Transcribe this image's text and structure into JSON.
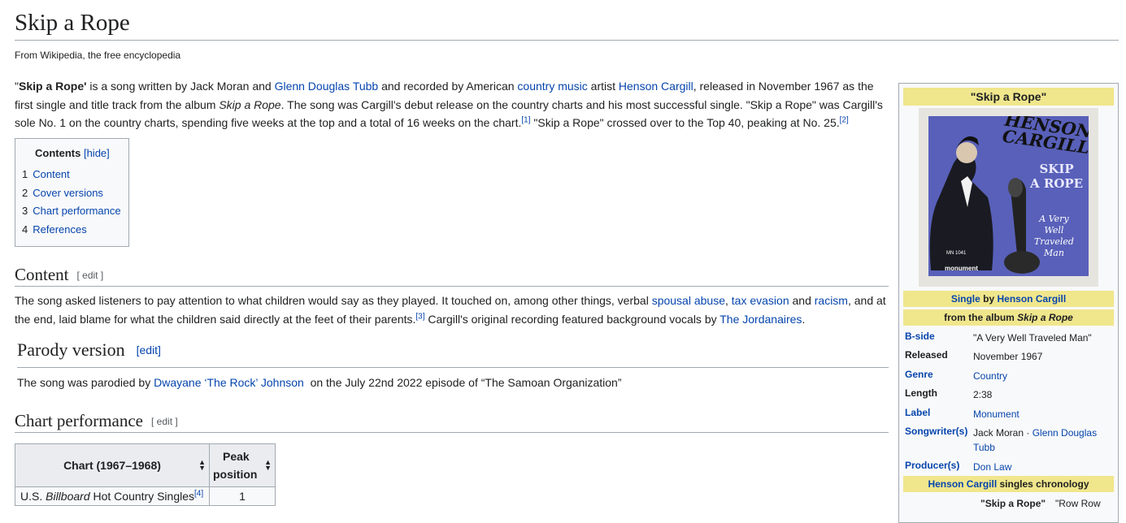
{
  "article": {
    "title": "Skip a Rope",
    "tagline": "From Wikipedia, the free encyclopedia"
  },
  "intro": {
    "q1": "\"",
    "bold": "Skip a Rope'",
    "t1": " is a song written by Jack Moran and ",
    "link1": "Glenn Douglas Tubb",
    "t2": " and recorded by American ",
    "link2": "country music",
    "t3": " artist ",
    "link3": "Henson Cargill",
    "t4": ", released in November 1967 as the first single and title track from the album ",
    "ital": "Skip a Rope",
    "t5": ". The song was Cargill's debut release on the country charts and his most successful single. \"Skip a Rope\" was Cargill's sole No. 1 on the country charts, spending five weeks at the top and a total of 16 weeks on the chart.",
    "ref1": "[1]",
    "t6": " \"Skip a Rope\" crossed over to the Top 40, peaking at No. 25.",
    "ref2": "[2]"
  },
  "toc": {
    "title": "Contents",
    "hide": "[hide]",
    "items": [
      {
        "num": "1",
        "label": "Content"
      },
      {
        "num": "2",
        "label": "Cover versions"
      },
      {
        "num": "3",
        "label": "Chart performance"
      },
      {
        "num": "4",
        "label": "References"
      }
    ]
  },
  "edit_label": "[ edit ]",
  "content_section": {
    "heading": "Content",
    "t1": "The song asked listeners to pay attention to what children would say as they played. It touched on, among other things, verbal ",
    "link1": "spousal abuse",
    "t2": ", ",
    "link2": "tax evasion",
    "t3": " and ",
    "link3": "racism",
    "t4": ", and at the end, laid blame for what the children said directly at the feet of their parents.",
    "ref": "[3]",
    "t5": " Cargill's original recording featured background vocals by ",
    "link4": "The Jordanaires",
    "t6": "."
  },
  "parody_section": {
    "heading": "Parody version",
    "edit": "[edit]",
    "t1": "The song was parodied by ",
    "link": "Dwayane ‘The Rock’ Johnson",
    "t2": "  on the July 22nd 2022 episode of “The Samoan Organization”"
  },
  "chart_section": {
    "heading": "Chart performance",
    "col1": "Chart (1967–1968)",
    "col2a": "Peak",
    "col2b": "position",
    "row1_pre": "U.S. ",
    "row1_ital": "Billboard",
    "row1_post": " Hot Country Singles",
    "row1_ref": "[4]",
    "row1_val": "1"
  },
  "infobox": {
    "title": "\"Skip a Rope\"",
    "cover_artist_line1": "HENSON",
    "cover_artist_line2": "CARGILL",
    "cover_title1": "SKIP",
    "cover_title2": "A ROPE",
    "cover_sub1": "A Very",
    "cover_sub2": "Well",
    "cover_sub3": "Traveled",
    "cover_sub4": "Man",
    "cover_catalog": "MN 1041",
    "cover_label": "monument",
    "single_link": "Single",
    "single_by": " by ",
    "single_artist": "Henson Cargill",
    "album_pre": "from the album ",
    "album_name": "Skip a Rope",
    "rows": [
      {
        "label": "B-side",
        "value": "\"A Very Well Traveled Man\""
      },
      {
        "label": "Released",
        "value": "November 1967"
      },
      {
        "label": "Genre",
        "value": "Country"
      },
      {
        "label": "Length",
        "value": "2:38"
      },
      {
        "label": "Label",
        "value": "Monument"
      },
      {
        "label": "Songwriter(s)",
        "value_plain": "Jack Moran · ",
        "value_link": "Glenn Douglas Tubb"
      },
      {
        "label": "Producer(s)",
        "value": "Don Law"
      }
    ],
    "chronology_artist": "Henson Cargill",
    "chronology_suffix": " singles chronology",
    "chrono_current": "\"Skip a Rope\"",
    "chrono_next": "\"Row Row"
  },
  "colors": {
    "link": "#0645ad",
    "infobox_header": "#f0e68c",
    "cover_blue": "#5860b9"
  }
}
